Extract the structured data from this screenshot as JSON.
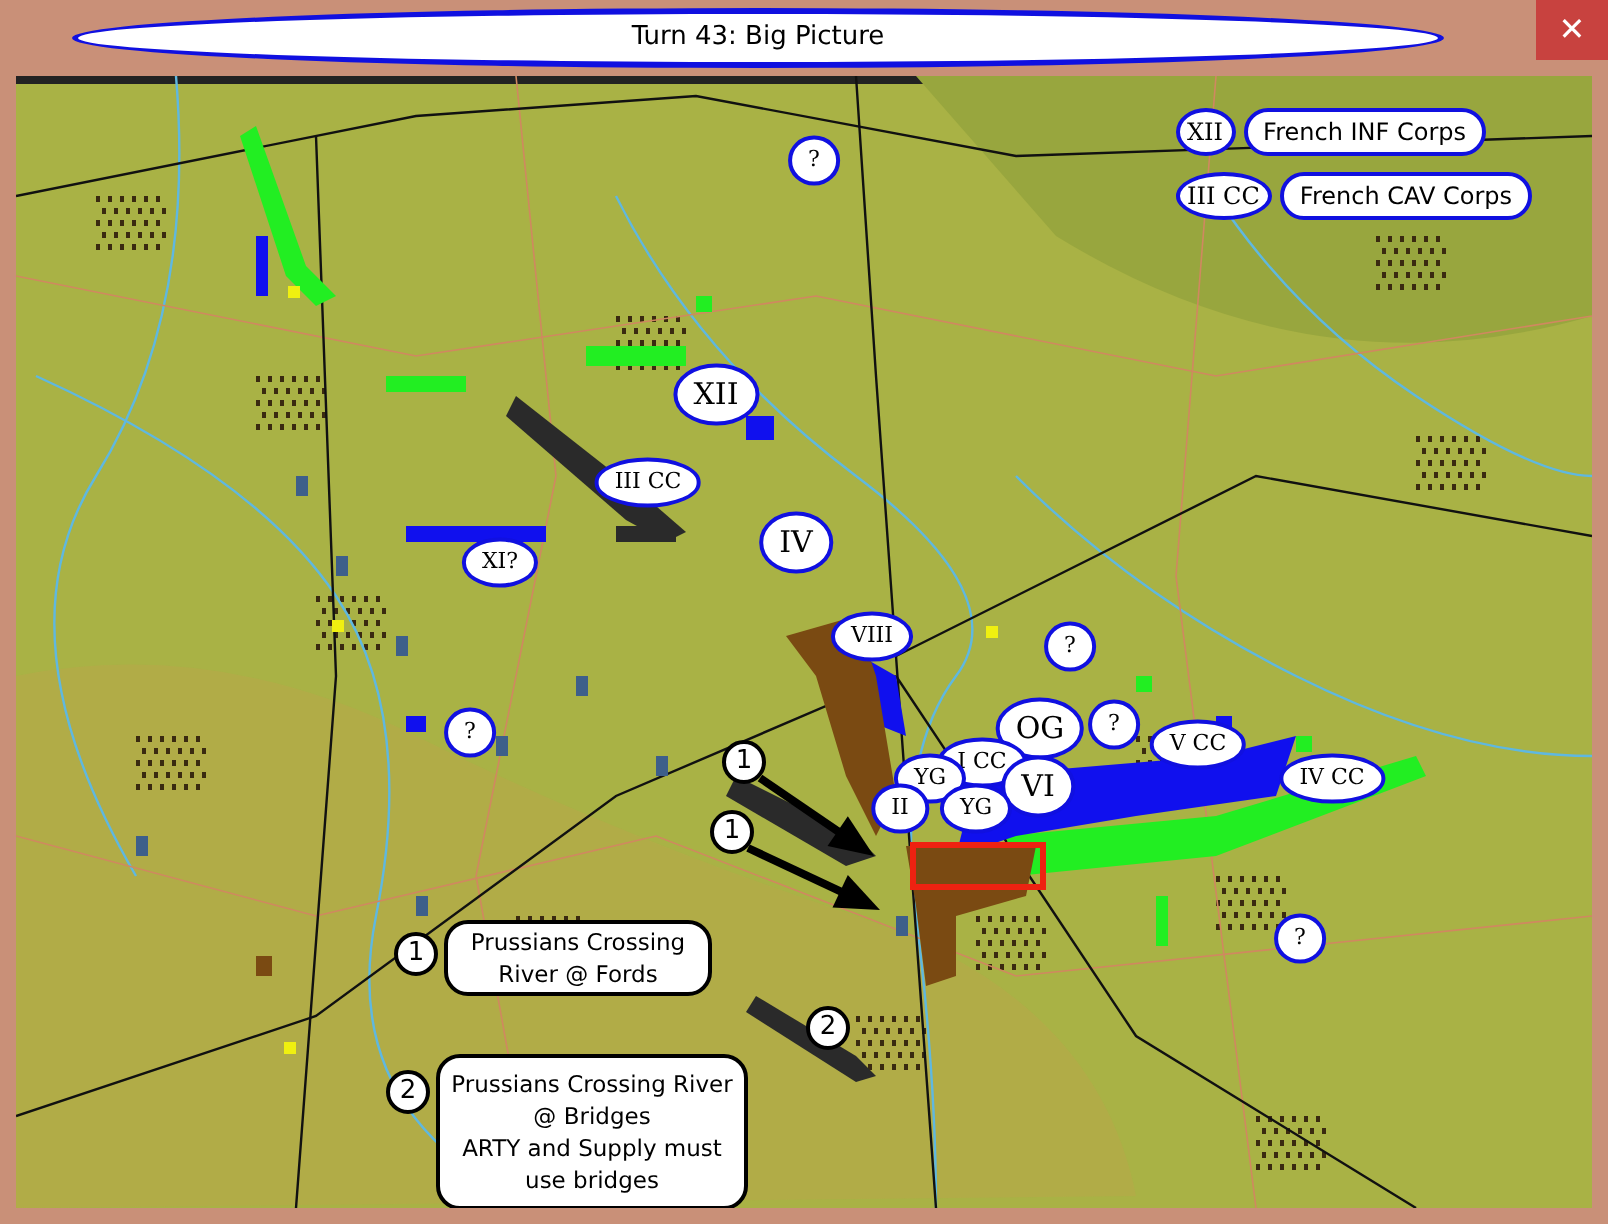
{
  "window": {
    "title": "Turn 43: Big Picture",
    "close_button": "✕"
  },
  "legend": [
    {
      "marker": "XII",
      "label": "French INF Corps"
    },
    {
      "marker": "III CC",
      "label": "French CAV Corps"
    }
  ],
  "unit_labels": [
    {
      "text": "?"
    },
    {
      "text": "XII"
    },
    {
      "text": "III CC"
    },
    {
      "text": "XI?"
    },
    {
      "text": "IV"
    },
    {
      "text": "VIII"
    },
    {
      "text": "?"
    },
    {
      "text": "?"
    },
    {
      "text": "OG"
    },
    {
      "text": "?"
    },
    {
      "text": "V CC"
    },
    {
      "text": "IV CC"
    },
    {
      "text": "I CC"
    },
    {
      "text": "YG"
    },
    {
      "text": "VI"
    },
    {
      "text": "II"
    },
    {
      "text": "YG"
    },
    {
      "text": "?"
    }
  ],
  "map_markers": [
    {
      "text": "1"
    },
    {
      "text": "1"
    },
    {
      "text": "2"
    }
  ],
  "callouts": [
    {
      "number": "1",
      "text": "Prussians Crossing\nRiver @ Fords"
    },
    {
      "number": "2",
      "text": "Prussians Crossing River\n@ Bridges\nARTY and Supply must\nuse bridges"
    }
  ]
}
